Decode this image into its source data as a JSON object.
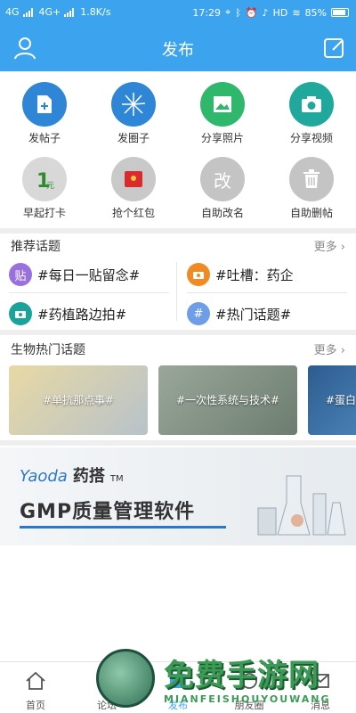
{
  "status_bar": {
    "net_left": "4G",
    "net_left2": "4G+",
    "speed": "1.8K/s",
    "time": "17:29",
    "hd": "HD",
    "battery": "85%"
  },
  "header": {
    "title": "发布"
  },
  "actions": [
    {
      "label": "发帖子",
      "icon": "post-icon",
      "color": "#2f86d6"
    },
    {
      "label": "发圈子",
      "icon": "circle-burst-icon",
      "color": "#2f86d6"
    },
    {
      "label": "分享照片",
      "icon": "photo-icon",
      "color": "#2fb86c"
    },
    {
      "label": "分享视频",
      "icon": "camera-icon",
      "color": "#20a89c"
    },
    {
      "label": "早起打卡",
      "icon": "checkin-icon",
      "color": "#d8d8d8"
    },
    {
      "label": "抢个红包",
      "icon": "red-packet-icon",
      "color": "#c9c9c9"
    },
    {
      "label": "自助改名",
      "icon": "rename-icon",
      "color": "#c4c4c4",
      "glyph": "改"
    },
    {
      "label": "自助删帖",
      "icon": "trash-icon",
      "color": "#c4c4c4"
    }
  ],
  "recommended": {
    "title": "推荐话题",
    "more": "更多",
    "topics": [
      {
        "label": "#每日一贴留念#",
        "icon": "post-topic-icon",
        "color": "#9a6fe0",
        "glyph": "贴"
      },
      {
        "label": "#吐槽：药企",
        "icon": "camera-topic-icon",
        "color": "#f08a24"
      },
      {
        "label": "#药植路边拍#",
        "icon": "camera-topic-icon",
        "color": "#1aa39a"
      },
      {
        "label": "#热门话题#",
        "icon": "hash-topic-icon",
        "color": "#6f9ee8",
        "glyph": "#"
      }
    ]
  },
  "bio_topics": {
    "title": "生物热门话题",
    "more": "更多",
    "cards": [
      {
        "label": "#单抗那点事#",
        "bg": "#c9b37a"
      },
      {
        "label": "#一次性系统与技术#",
        "bg": "#8a9a88"
      },
      {
        "label": "#蛋白",
        "bg": "#3a6fa5"
      }
    ]
  },
  "banner": {
    "brand_en": "Yaoda",
    "brand_cn": "药搭",
    "tm": "TM",
    "title": "GMP质量管理软件"
  },
  "bottom_nav": [
    {
      "label": "首页",
      "icon": "home-icon",
      "active": false
    },
    {
      "label": "论坛",
      "icon": "forum-icon",
      "active": false
    },
    {
      "label": "发布",
      "icon": "publish-icon",
      "active": true
    },
    {
      "label": "朋友圈",
      "icon": "moments-icon",
      "active": false
    },
    {
      "label": "消息",
      "icon": "message-icon",
      "active": false
    }
  ],
  "watermark": {
    "text": "免费手游网",
    "sub": "MIANFEISHOUYOUWANG"
  }
}
